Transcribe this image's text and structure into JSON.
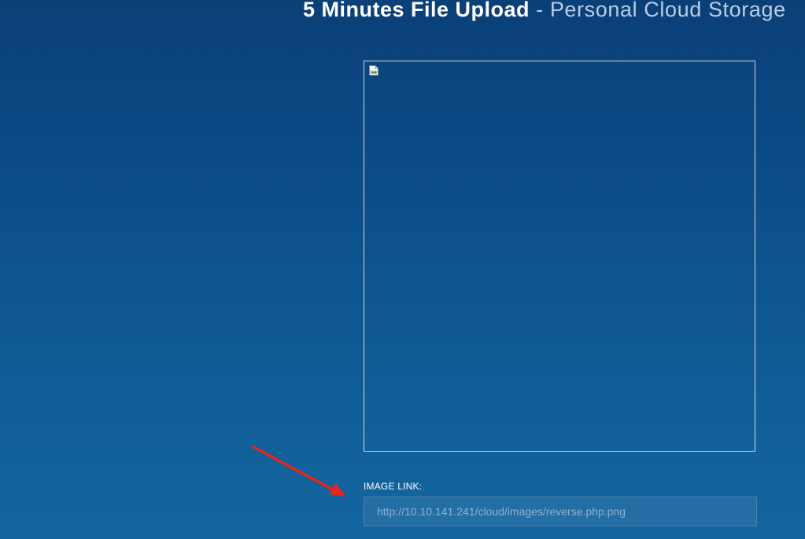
{
  "header": {
    "title_main": "5 Minutes File Upload",
    "separator": " - ",
    "subtitle": "Personal Cloud Storage"
  },
  "preview": {
    "icon": "broken-image-icon"
  },
  "image_link": {
    "label": "IMAGE LINK:",
    "value": "http://10.10.141.241/cloud/images/reverse.php.png"
  },
  "annotation": {
    "icon": "red-arrow",
    "color": "#e8241d"
  },
  "colors": {
    "background_top": "#0b3f78",
    "background_bottom": "#1466a0"
  }
}
